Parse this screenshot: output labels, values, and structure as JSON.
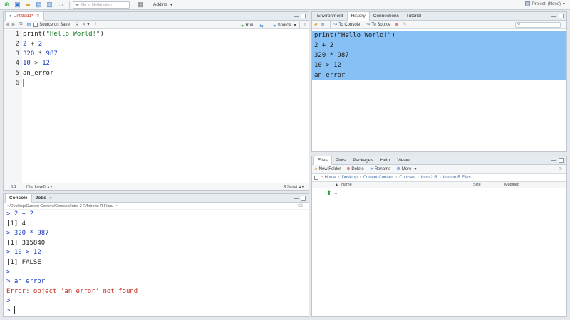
{
  "toolbar": {
    "goto_placeholder": "Go to file/function",
    "addins_label": "Addins",
    "project_label": "Project: (None)"
  },
  "editor": {
    "tab_title": "Untitled1*",
    "source_on_save": "Source on Save",
    "run_label": "Run",
    "source_label": "Source",
    "line_numbers": [
      "1",
      "2",
      "3",
      "4",
      "5",
      "6"
    ],
    "status_position": "6:1",
    "status_scope": "(Top Level)",
    "status_filetype": "R Script"
  },
  "console": {
    "tab_console": "Console",
    "tab_jobs": "Jobs",
    "path": "~/Desktop/Current Content/Courses/Intro 2 R/Intro to R Files/",
    "lines": [
      {
        "kind": "prompt",
        "text": "> 2 + 2"
      },
      {
        "kind": "output",
        "text": "[1] 4"
      },
      {
        "kind": "prompt",
        "text": "> 320 * 987"
      },
      {
        "kind": "output",
        "text": "[1] 315840"
      },
      {
        "kind": "prompt",
        "text": "> 10 > 12"
      },
      {
        "kind": "output",
        "text": "[1] FALSE"
      },
      {
        "kind": "prompt",
        "text": ">"
      },
      {
        "kind": "prompt",
        "text": "> an_error"
      },
      {
        "kind": "error",
        "text": "Error: object 'an_error' not found"
      },
      {
        "kind": "prompt",
        "text": ">"
      },
      {
        "kind": "prompt",
        "text": "> "
      }
    ]
  },
  "env": {
    "tabs": [
      "Environment",
      "History",
      "Connections",
      "Tutorial"
    ],
    "to_console": "To Console",
    "to_source": "To Source",
    "history": [
      "print(\"Hello World!\")",
      "2 + 2",
      "320 * 987",
      "10 > 12",
      "an_error"
    ]
  },
  "files": {
    "tabs": [
      "Files",
      "Plots",
      "Packages",
      "Help",
      "Viewer"
    ],
    "new_folder": "New Folder",
    "delete": "Delete",
    "rename": "Rename",
    "more": "More",
    "breadcrumbs": [
      "Home",
      "Desktop",
      "Current Content",
      "Courses",
      "Intro 2 R",
      "Intro to R Files"
    ],
    "col_name": "Name",
    "col_size": "Size",
    "col_modified": "Modified",
    "parent_dir": ".."
  }
}
